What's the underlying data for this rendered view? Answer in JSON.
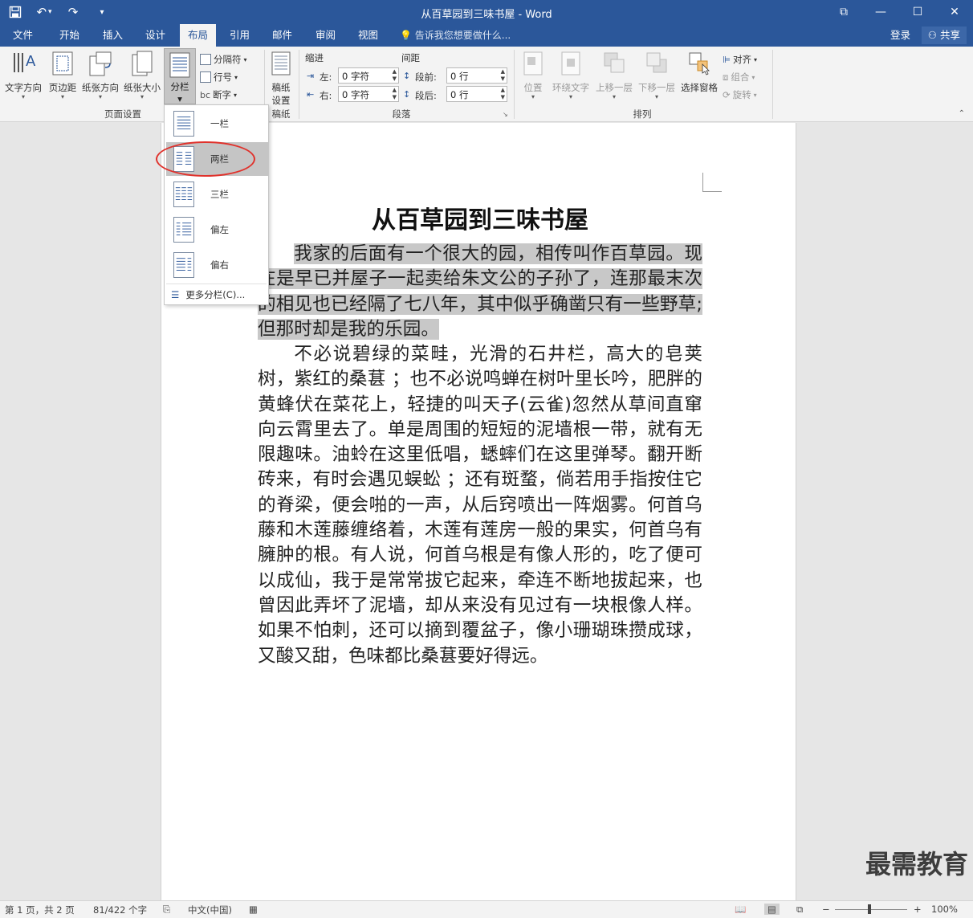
{
  "window": {
    "title": "从百草园到三味书屋 - Word",
    "controls": {
      "restore_ribbon": "⧉",
      "minimize": "—",
      "maximize": "☐",
      "close": "✕"
    }
  },
  "qat": {
    "undo_dd": "▾",
    "customize": "▾"
  },
  "tabs": [
    {
      "label": "文件",
      "active": false
    },
    {
      "label": "开始",
      "active": false
    },
    {
      "label": "插入",
      "active": false
    },
    {
      "label": "设计",
      "active": false
    },
    {
      "label": "布局",
      "active": true
    },
    {
      "label": "引用",
      "active": false
    },
    {
      "label": "邮件",
      "active": false
    },
    {
      "label": "审阅",
      "active": false
    },
    {
      "label": "视图",
      "active": false
    }
  ],
  "tellme": "告诉我您想要做什么...",
  "account": {
    "login": "登录",
    "share": "共享"
  },
  "ribbon": {
    "page_setup": {
      "label": "页面设置",
      "text_direction": "文字方向",
      "margins": "页边距",
      "orientation": "纸张方向",
      "size": "纸张大小",
      "columns": "分栏",
      "breaks": "分隔符",
      "line_numbers": "行号",
      "hyphenation": "断字"
    },
    "draft": {
      "label": "稿纸",
      "settings_line1": "稿纸",
      "settings_line2": "设置"
    },
    "paragraph": {
      "label": "段落",
      "indent_label": "缩进",
      "spacing_label": "间距",
      "left_label": "左:",
      "right_label": "右:",
      "before_label": "段前:",
      "after_label": "段后:",
      "left_value": "0 字符",
      "right_value": "0 字符",
      "before_value": "0 行",
      "after_value": "0 行"
    },
    "arrange": {
      "label": "排列",
      "position": "位置",
      "wrap_text": "环绕文字",
      "bring_forward": "上移一层",
      "send_backward": "下移一层",
      "selection_pane": "选择窗格",
      "align": "对齐",
      "group": "组合",
      "rotate": "旋转"
    }
  },
  "columns_menu": {
    "items": [
      {
        "label": "一栏",
        "cols": 1
      },
      {
        "label": "两栏",
        "cols": 2
      },
      {
        "label": "三栏",
        "cols": 3
      },
      {
        "label": "偏左",
        "cols": 2
      },
      {
        "label": "偏右",
        "cols": 2
      }
    ],
    "more": "更多分栏(C)..."
  },
  "document": {
    "title": "从百草园到三味书屋",
    "para1": "我家的后面有一个很大的园，相传叫作百草园。现在是早已并屋子一起卖给朱文公的子孙了，连那最末次的相见也已经隔了七八年，其中似乎确凿只有一些野草;但那时却是我的乐园。",
    "para2": "不必说碧绿的菜畦，光滑的石井栏，高大的皂荚树，紫红的桑葚 ；也不必说鸣蝉在树叶里长吟，肥胖的黄蜂伏在菜花上，轻捷的叫天子(云雀)忽然从草间直窜向云霄里去了。单是周围的短短的泥墙根一带，就有无限趣味。油蛉在这里低唱，蟋蟀们在这里弹琴。翻开断砖来，有时会遇见蜈蚣 ；还有斑蝥，倘若用手指按住它的脊梁，便会啪的一声，从后窍喷出一阵烟雾。何首乌藤和木莲藤缠络着，木莲有莲房一般的果实，何首乌有臃肿的根。有人说，何首乌根是有像人形的，吃了便可以成仙，我于是常常拔它起来，牵连不断地拔起来，也曾因此弄坏了泥墙，却从来没有见过有一块根像人样。如果不怕刺，还可以摘到覆盆子，像小珊瑚珠攒成球，又酸又甜，色味都比桑葚要好得远。"
  },
  "watermark": "最需教育",
  "status": {
    "page": "第 1 页，共 2 页",
    "words": "81/422 个字",
    "language": "中文(中国)",
    "zoom": "100%",
    "zoom_minus": "−",
    "zoom_plus": "+"
  },
  "colors": {
    "brand": "#2b579a",
    "selection": "#c8c8c8",
    "highlight_ring": "#e0322c"
  }
}
